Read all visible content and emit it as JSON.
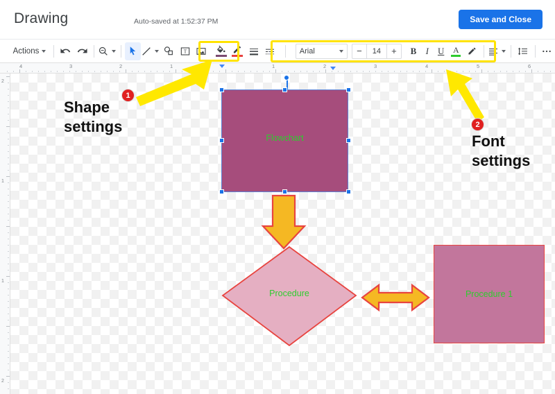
{
  "header": {
    "title": "Drawing",
    "autosave": "Auto-saved at 1:52:37 PM",
    "save_button": "Save and Close"
  },
  "toolbar": {
    "actions_label": "Actions",
    "icons": [
      {
        "name": "undo-icon",
        "label": "Undo"
      },
      {
        "name": "redo-icon",
        "label": "Redo"
      },
      {
        "name": "zoom-icon",
        "label": "Zoom"
      },
      {
        "name": "select-arrow-icon",
        "label": "Select"
      },
      {
        "name": "line-icon",
        "label": "Line"
      },
      {
        "name": "shape-icon",
        "label": "Shape"
      },
      {
        "name": "text-box-icon",
        "label": "Text box"
      },
      {
        "name": "image-icon",
        "label": "Image"
      },
      {
        "name": "fill-color-icon",
        "label": "Fill color"
      },
      {
        "name": "border-color-icon",
        "label": "Border color"
      },
      {
        "name": "border-weight-icon",
        "label": "Border weight"
      },
      {
        "name": "border-dash-icon",
        "label": "Border dash"
      },
      {
        "name": "align-icon",
        "label": "Align"
      },
      {
        "name": "line-spacing-icon",
        "label": "Line spacing"
      },
      {
        "name": "more-icon",
        "label": "More"
      }
    ],
    "font": {
      "family": "Arial",
      "size": "14",
      "decrease": "−",
      "increase": "+",
      "bold": "B",
      "italic": "I",
      "underline": "U",
      "text_color": "A",
      "highlight_color": "highlight",
      "fill_swatch_color": "#7b4a70",
      "border_swatch_color": "#e8443f",
      "text_color_swatch": "#2ecc2e"
    }
  },
  "rulers": {
    "horizontal_ticks": [
      "4",
      "3",
      "2",
      "1",
      "1",
      "2",
      "3",
      "4",
      "5",
      "6"
    ],
    "vertical_ticks": [
      "2",
      "1",
      "1",
      "2"
    ]
  },
  "canvas": {
    "shapes": [
      {
        "name": "rect-flowchart",
        "type": "rectangle",
        "label": "Flowchart",
        "fill": "#a64d7c",
        "border": "#5b83d6",
        "text_color": "#2ecc2e",
        "selected": true
      },
      {
        "name": "arrow-down",
        "type": "down-arrow",
        "fill": "#f5b823",
        "border": "#e8443f"
      },
      {
        "name": "diamond-procedure",
        "type": "diamond",
        "label": "Procedure",
        "fill": "#e5afc2",
        "border": "#e8443f",
        "text_color": "#2ecc2e",
        "selected": false
      },
      {
        "name": "arrow-left-right",
        "type": "double-arrow",
        "fill": "#f5b823",
        "border": "#e8443f"
      },
      {
        "name": "rect-procedure1",
        "type": "rectangle",
        "label": "Procedure 1",
        "fill": "#c2769c",
        "border": "#e8443f",
        "text_color": "#2ecc2e",
        "selected": false
      }
    ]
  },
  "annotations": [
    {
      "name": "annotation-shape-settings",
      "badge": "1",
      "line1": "Shape",
      "line2": "settings",
      "arrow_color": "#ffe800",
      "badge_color": "#e02020"
    },
    {
      "name": "annotation-font-settings",
      "badge": "2",
      "line1": "Font",
      "line2": "settings",
      "arrow_color": "#ffe800",
      "badge_color": "#e02020"
    }
  ],
  "highlights": {
    "shape_settings_color": "#ffe300",
    "font_settings_color": "#ffe300"
  }
}
